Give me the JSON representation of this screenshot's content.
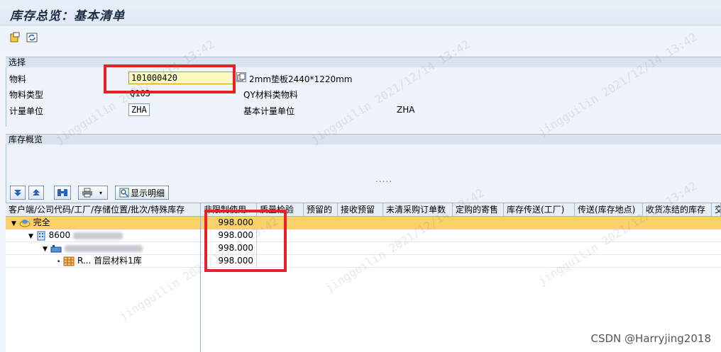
{
  "window": {
    "title": "库存总览：基本清单"
  },
  "toolbar": {
    "icons": [
      "select-layout-icon",
      "refresh-icon"
    ]
  },
  "selection": {
    "section_title": "选择",
    "material_label": "物料",
    "material_value": "101000420",
    "material_desc": "2mm垫板2440*1220mm",
    "material_type_label": "物料类型",
    "material_type_value": "Q103",
    "material_type_desc": "QY材料类物料",
    "uom_label": "计量单位",
    "uom_value": "ZHA",
    "base_uom_label": "基本计量单位",
    "base_uom_value": "ZHA"
  },
  "overview": {
    "section_title": "库存概览",
    "splitter": ".....",
    "detail_button": "显示明细"
  },
  "grid": {
    "columns": [
      "客户端/公司代码/工厂/存储位置/批次/特殊库存",
      "非限制使用",
      "质量检验",
      "预留的",
      "接收预留",
      "未清采购订单数",
      "定购的寄售",
      "库存传送(工厂)",
      "传送(库存地点)",
      "收货冻结的库存",
      "交"
    ],
    "rows": [
      {
        "label": "完全",
        "value": "998.000"
      },
      {
        "label": "8600",
        "value": "998.000"
      },
      {
        "label": "8600",
        "value": "998.000"
      },
      {
        "label": "R... 首层材料1库",
        "value": "998.000"
      }
    ]
  },
  "watermark": "jingguilin 2021/12/14 13:42",
  "credit": "CSDN @Harryjing2018",
  "colors": {
    "highlight": "#e8202a",
    "selected_row": "#fcd06a",
    "panel": "#eef3fa"
  }
}
